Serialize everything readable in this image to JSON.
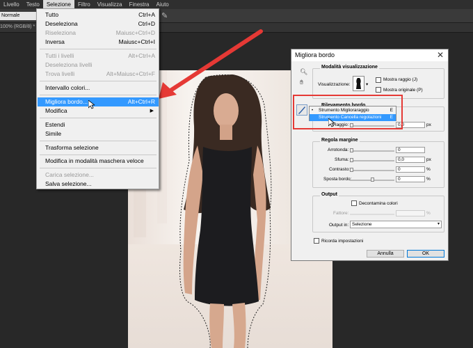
{
  "menubar": {
    "items": [
      "Livello",
      "Testo",
      "Selezione",
      "Filtro",
      "Visualizza",
      "Finestra",
      "Aiuto"
    ],
    "active": "Selezione"
  },
  "options_bar": {
    "blend_mode": "Normale"
  },
  "doc_tab": {
    "label": "100% (RGB/8) *"
  },
  "selection_menu": {
    "items": [
      {
        "label": "Tutto",
        "shortcut": "Ctrl+A",
        "disabled": false
      },
      {
        "label": "Deseleziona",
        "shortcut": "Ctrl+D",
        "disabled": false
      },
      {
        "label": "Riseleziona",
        "shortcut": "Maiusc+Ctrl+D",
        "disabled": true
      },
      {
        "label": "Inversa",
        "shortcut": "Maiusc+Ctrl+I",
        "disabled": false
      },
      {
        "label": "Tutti i livelli",
        "shortcut": "Alt+Ctrl+A",
        "disabled": true
      },
      {
        "label": "Deseleziona livelli",
        "shortcut": "",
        "disabled": true
      },
      {
        "label": "Trova livelli",
        "shortcut": "Alt+Maiusc+Ctrl+F",
        "disabled": true
      },
      {
        "label": "Intervallo colori...",
        "shortcut": "",
        "disabled": false
      },
      {
        "label": "Migliora bordo...",
        "shortcut": "Alt+Ctrl+R",
        "disabled": false,
        "highlighted": true
      },
      {
        "label": "Modifica",
        "shortcut": "",
        "disabled": false,
        "submenu": true
      },
      {
        "label": "Estendi",
        "shortcut": "",
        "disabled": false
      },
      {
        "label": "Simile",
        "shortcut": "",
        "disabled": false
      },
      {
        "label": "Trasforma selezione",
        "shortcut": "",
        "disabled": false
      },
      {
        "label": "Modifica in modalità maschera veloce",
        "shortcut": "",
        "disabled": false
      },
      {
        "label": "Carica selezione...",
        "shortcut": "",
        "disabled": true
      },
      {
        "label": "Salva selezione...",
        "shortcut": "",
        "disabled": false
      }
    ]
  },
  "dialog": {
    "title": "Migliora bordo",
    "view_mode": {
      "group_title": "Modalità visualizzazione",
      "view_label": "Visualizzazione:",
      "show_radius": "Mostra raggio (J)",
      "show_original": "Mostra originale (P)"
    },
    "edge_detection": {
      "group_title": "Rilevamento bordo",
      "radius_label": "Raggio:",
      "radius_value": "0,0",
      "radius_unit": "px"
    },
    "tools_popup": [
      {
        "label": "Strumento Miglioraraggio",
        "key": "E",
        "selected": true
      },
      {
        "label": "Strumento Cancella regolazioni",
        "key": "E",
        "highlighted": true
      }
    ],
    "adjust_edge": {
      "group_title": "Regola margine",
      "rows": [
        {
          "label": "Arrotonda:",
          "value": "0",
          "unit": ""
        },
        {
          "label": "Sfuma:",
          "value": "0,0",
          "unit": "px"
        },
        {
          "label": "Contrasto:",
          "value": "0",
          "unit": "%"
        },
        {
          "label": "Sposta bordo:",
          "value": "0",
          "unit": "%"
        }
      ],
      "slider_levels": [
        0,
        0,
        0,
        0.5
      ]
    },
    "output": {
      "group_title": "Output",
      "decontaminate": "Decontamina colori",
      "amount_label": "Fattore:",
      "amount_unit": "%",
      "output_to_label": "Output in:",
      "output_to_value": "Selezione"
    },
    "remember": "Ricorda impostazioni",
    "cancel": "Annulla",
    "ok": "OK"
  },
  "colors": {
    "highlight": "#3399ff",
    "annotation_red": "#e53935"
  }
}
